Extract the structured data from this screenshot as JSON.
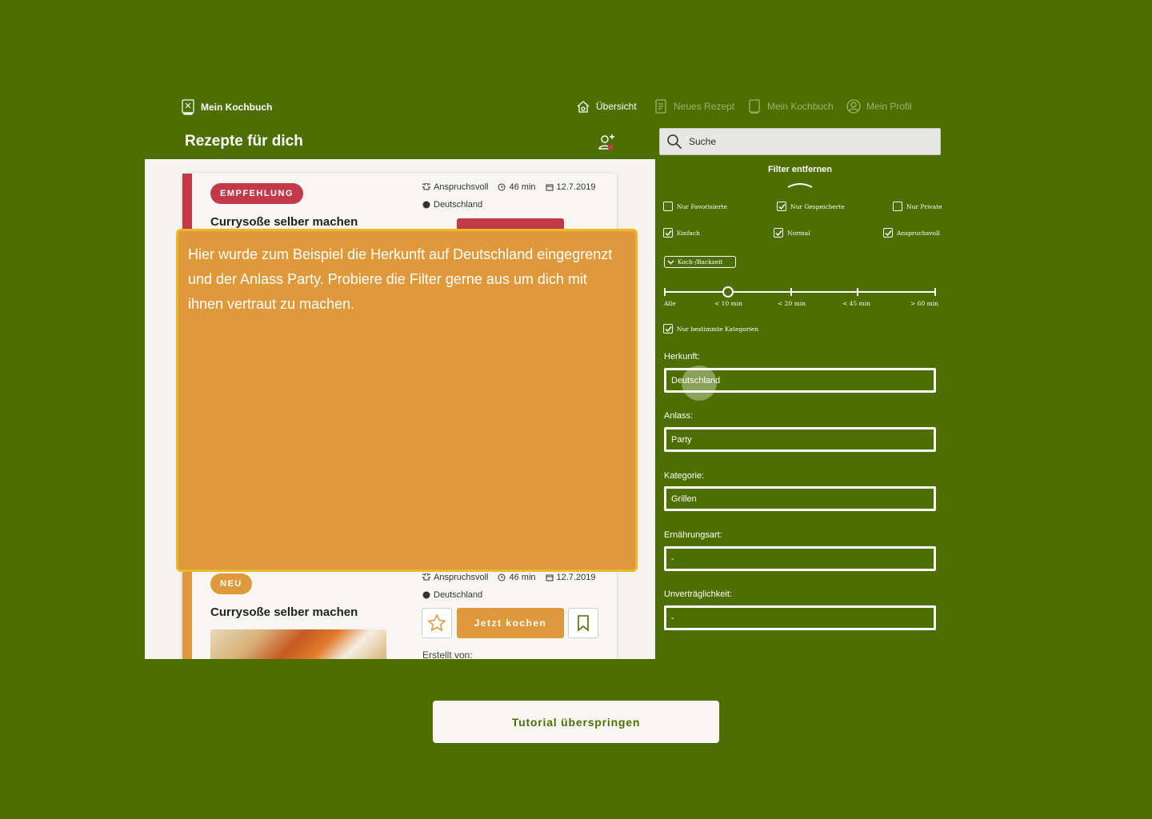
{
  "header": {
    "brand": "Mein Kochbuch",
    "nav": [
      {
        "label": "Übersicht",
        "icon": "home-icon",
        "active": true
      },
      {
        "label": "Neues Rezept",
        "icon": "note-icon",
        "active": false
      },
      {
        "label": "Mein Kochbuch",
        "icon": "book-icon",
        "active": false
      },
      {
        "label": "Mein Profil",
        "icon": "user-circle-icon",
        "active": false
      }
    ]
  },
  "page_title": "Rezepte für dich",
  "search": {
    "placeholder": "Suche"
  },
  "cards": [
    {
      "badge": "EMPFEHLUNG",
      "badge_color": "#c2394a",
      "title": "Currysoße selber machen",
      "difficulty": "Anspruchsvoll",
      "time": "46 min",
      "date": "12.7.2019",
      "origin": "Deutschland"
    },
    {
      "badge": "NEU",
      "badge_color": "#e0993a",
      "title": "Currysoße selber machen",
      "difficulty": "Anspruchsvoll",
      "time": "46 min",
      "date": "12.7.2019",
      "origin": "Deutschland",
      "cook_label": "Jetzt kochen",
      "created_by": "Erstellt von:"
    }
  ],
  "tutorial_text": "Hier wurde zum Beispiel die Herkunft auf Deutschland eingegrenzt und der Anlass Party. Probiere die Filter gerne aus um dich mit ihnen vertraut zu machen.",
  "filter": {
    "remove_label": "Filter entfernen",
    "checkboxes_row1": [
      {
        "label": "Nur Favorisierte",
        "checked": false
      },
      {
        "label": "Nur Gespeicherte",
        "checked": true
      },
      {
        "label": "Nur Private",
        "checked": false
      }
    ],
    "checkboxes_row2": [
      {
        "label": "Einfach",
        "checked": true
      },
      {
        "label": "Normal",
        "checked": true
      },
      {
        "label": "Anspruchsvoll",
        "checked": true
      }
    ],
    "time_dropdown": "Koch-/Backzeit",
    "slider_labels": [
      "Alle",
      "< 10 min",
      "< 20 min",
      "< 45 min",
      "> 60 min"
    ],
    "slider_selected_index": 1,
    "categories_only": "Nur bestimmte Kategorien",
    "fields": [
      {
        "label": "Herkunft:",
        "value": "Deutschland"
      },
      {
        "label": "Anlass:",
        "value": "Party"
      },
      {
        "label": "Kategorie:",
        "value": "Grillen"
      },
      {
        "label": "Ernährungsart:",
        "value": "-"
      },
      {
        "label": "Unverträglichkeit:",
        "value": "-"
      }
    ]
  },
  "skip_button": "Tutorial überspringen",
  "colors": {
    "background": "#4d6e00",
    "accent_orange": "#e0993a",
    "accent_red": "#c2394a"
  }
}
